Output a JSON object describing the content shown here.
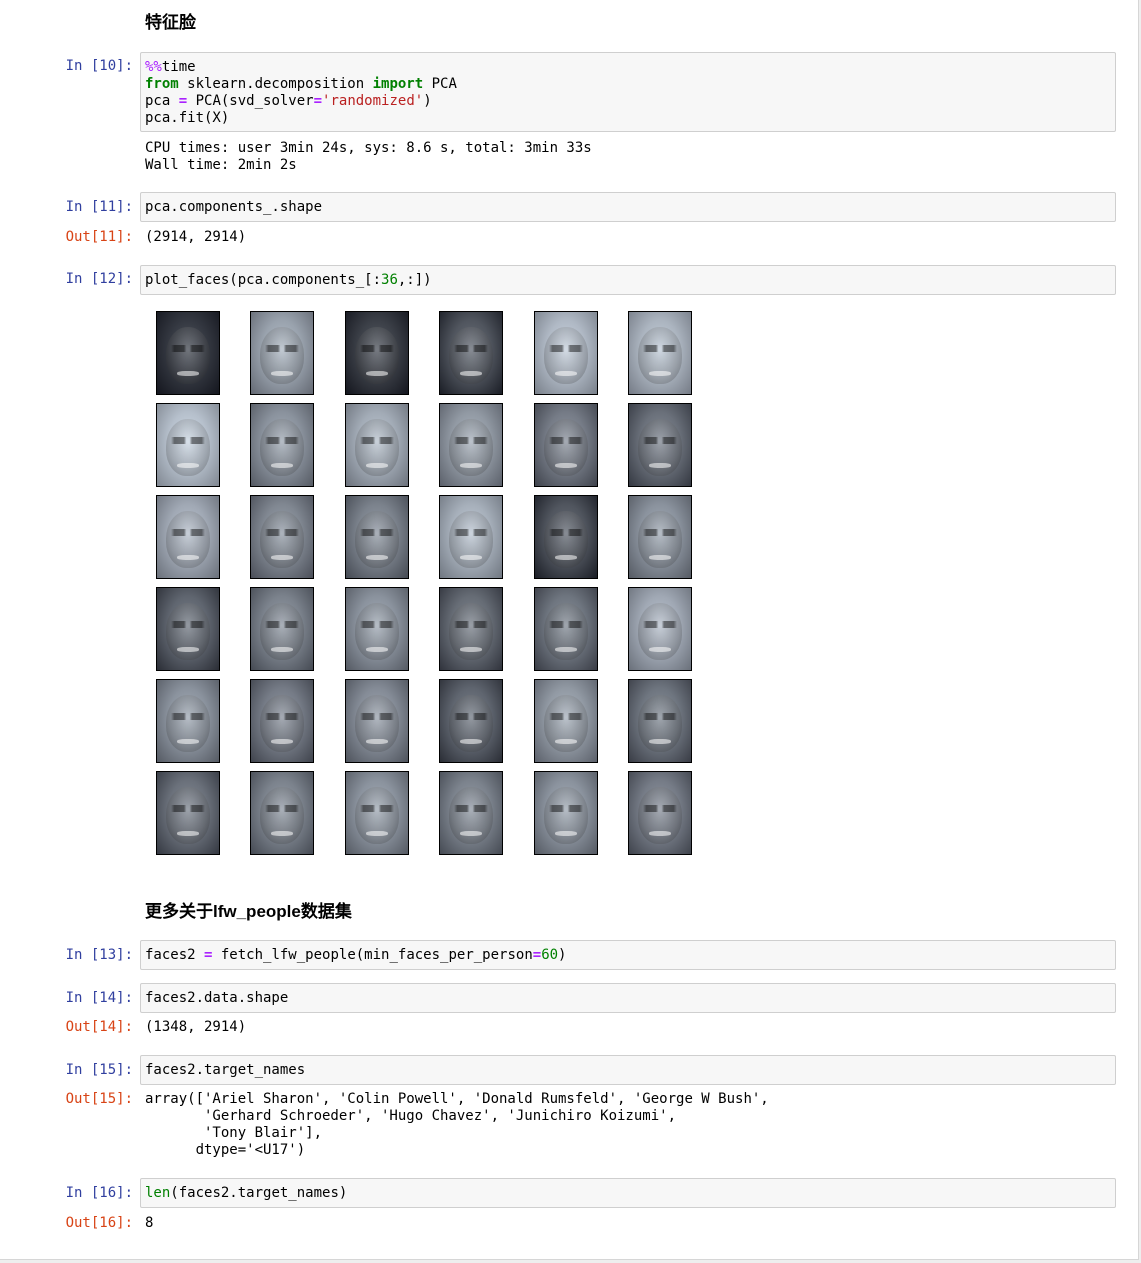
{
  "sections": {
    "eigenfaces_heading": "特征脸",
    "lfw_heading": "更多关于lfw_people数据集"
  },
  "cells": {
    "c10": {
      "prompt": "In [10]:",
      "output_lines": [
        "CPU times: user 3min 24s, sys: 8.6 s, total: 3min 33s",
        "Wall time: 2min 2s"
      ]
    },
    "c11": {
      "prompt": "In [11]:",
      "out_prompt": "Out[11]:",
      "output": "(2914, 2914)"
    },
    "c12": {
      "prompt": "In [12]:"
    },
    "c13": {
      "prompt": "In [13]:"
    },
    "c14": {
      "prompt": "In [14]:",
      "out_prompt": "Out[14]:",
      "output": "(1348, 2914)"
    },
    "c15": {
      "prompt": "In [15]:",
      "out_prompt": "Out[15]:",
      "output": "array(['Ariel Sharon', 'Colin Powell', 'Donald Rumsfeld', 'George W Bush',\n       'Gerhard Schroeder', 'Hugo Chavez', 'Junichiro Koizumi',\n       'Tony Blair'],\n      dtype='<U17')"
    },
    "c16": {
      "prompt": "In [16]:",
      "out_prompt": "Out[16]:",
      "output": "8"
    }
  },
  "code_tokens": {
    "c10_l1_magic": "%%",
    "c10_l1_rest": "time",
    "c10_l2_from": "from",
    "c10_l2_mod": " sklearn.decomposition ",
    "c10_l2_import": "import",
    "c10_l2_name": " PCA",
    "c10_l3_a": "pca ",
    "c10_l3_eq": "=",
    "c10_l3_b": " PCA(svd_solver",
    "c10_l3_eq2": "=",
    "c10_l3_str": "'randomized'",
    "c10_l3_c": ")",
    "c10_l4": "pca.fit(X)",
    "c11": "pca.components_.shape",
    "c12_a": "plot_faces(pca.components_[:",
    "c12_num": "36",
    "c12_b": ",:])",
    "c13_a": "faces2 ",
    "c13_eq": "=",
    "c13_b": " fetch_lfw_people(min_faces_per_person",
    "c13_eq2": "=",
    "c13_num": "60",
    "c13_c": ")",
    "c14": "faces2.data.shape",
    "c15": "faces2.target_names",
    "c16_len": "len",
    "c16_rest": "(faces2.target_names)"
  },
  "faces_grid": {
    "rows": 6,
    "cols": 6,
    "colormap": "bone",
    "brightness": [
      [
        0.15,
        0.62,
        0.18,
        0.28,
        0.72,
        0.7
      ],
      [
        0.75,
        0.55,
        0.66,
        0.58,
        0.45,
        0.4
      ],
      [
        0.65,
        0.5,
        0.48,
        0.68,
        0.28,
        0.55
      ],
      [
        0.35,
        0.48,
        0.55,
        0.38,
        0.42,
        0.65
      ],
      [
        0.55,
        0.45,
        0.52,
        0.35,
        0.58,
        0.42
      ],
      [
        0.4,
        0.48,
        0.55,
        0.48,
        0.55,
        0.45
      ]
    ]
  }
}
